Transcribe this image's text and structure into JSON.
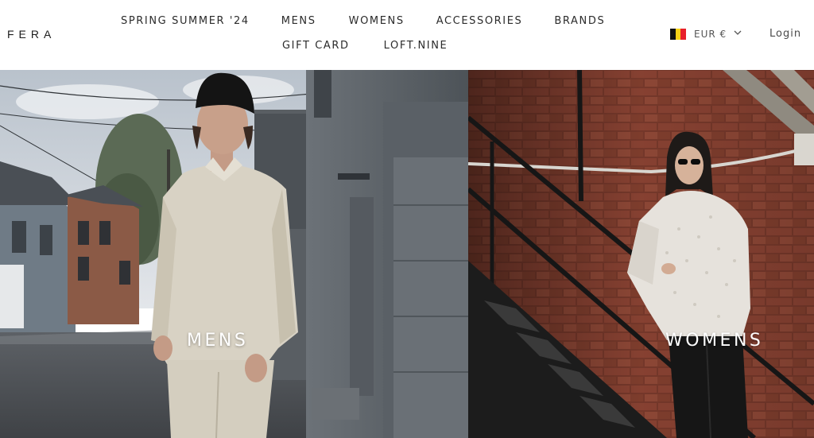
{
  "brand": {
    "logo_text": "FERA"
  },
  "nav": {
    "row1": [
      "SPRING SUMMER '24",
      "MENS",
      "WOMENS",
      "ACCESSORIES",
      "BRANDS"
    ],
    "row2": [
      "GIFT CARD",
      "LOFT.NINE"
    ]
  },
  "currency": {
    "label": "EUR €",
    "flag_colors": [
      "#111111",
      "#f7d117",
      "#e8202a"
    ]
  },
  "account": {
    "login_label": "Login"
  },
  "hero": {
    "mens_label": "MENS",
    "womens_label": "WOMENS"
  },
  "colors": {
    "text": "#2b2b2b",
    "overlay_text": "#ffffff"
  }
}
